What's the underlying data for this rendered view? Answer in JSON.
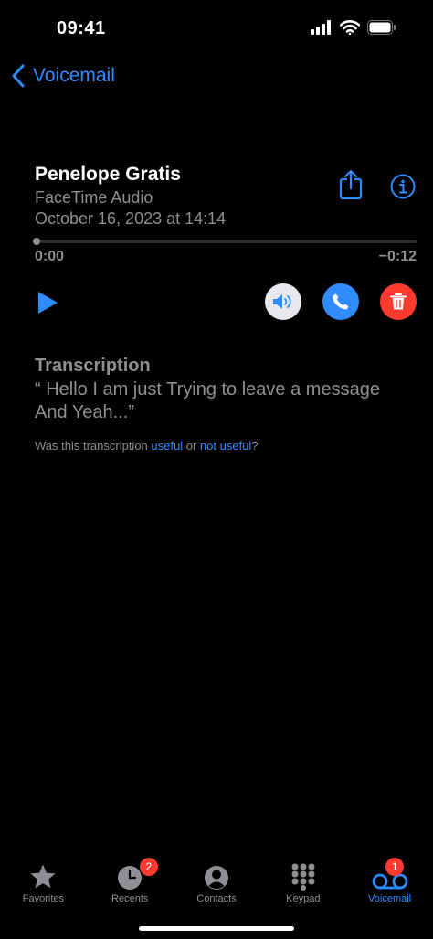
{
  "status_bar": {
    "time": "09:41"
  },
  "nav": {
    "back_label": "Voicemail"
  },
  "voicemail": {
    "caller_name": "Penelope Gratis",
    "call_type": "FaceTime Audio",
    "date": "October 16, 2023 at 14:14",
    "elapsed": "0:00",
    "remaining": "−0:12",
    "progress_fraction": 0
  },
  "transcription": {
    "heading": "Transcription",
    "text": "“ Hello I am just Trying to leave a message And Yeah...”",
    "feedback_prefix": "Was this transcription ",
    "useful": "useful",
    "or": " or ",
    "not_useful": "not useful",
    "feedback_suffix": "?"
  },
  "tabs": [
    {
      "label": "Favorites",
      "icon": "star-icon"
    },
    {
      "label": "Recents",
      "icon": "clock-icon",
      "badge": "2"
    },
    {
      "label": "Contacts",
      "icon": "person-circle-icon"
    },
    {
      "label": "Keypad",
      "icon": "keypad-icon"
    },
    {
      "label": "Voicemail",
      "icon": "voicemail-icon",
      "badge": "1",
      "active": true
    }
  ],
  "colors": {
    "accent": "#2f8cff",
    "delete": "#ff3b30",
    "secondary_text": "#8e8e93",
    "background": "#000000"
  }
}
